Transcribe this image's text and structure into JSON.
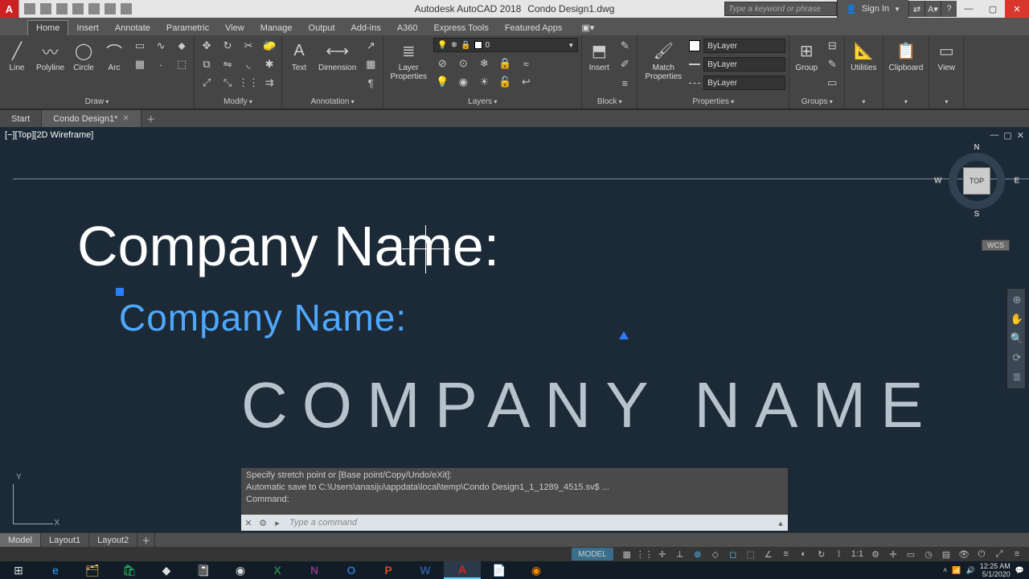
{
  "title": {
    "app": "Autodesk AutoCAD 2018",
    "file": "Condo Design1.dwg"
  },
  "search_placeholder": "Type a keyword or phrase",
  "signin": "Sign In",
  "menutabs": [
    "Home",
    "Insert",
    "Annotate",
    "Parametric",
    "View",
    "Manage",
    "Output",
    "Add-ins",
    "A360",
    "Express Tools",
    "Featured Apps"
  ],
  "ribbon": {
    "draw": {
      "title": "Draw",
      "btns": [
        "Line",
        "Polyline",
        "Circle",
        "Arc"
      ]
    },
    "modify": {
      "title": "Modify"
    },
    "annotation": {
      "title": "Annotation",
      "btns": [
        "Text",
        "Dimension"
      ]
    },
    "layers": {
      "title": "Layers",
      "btn": "Layer Properties",
      "current": "0"
    },
    "block": {
      "title": "Block",
      "btns": [
        "Insert"
      ]
    },
    "properties": {
      "title": "Properties",
      "match": "Match Properties",
      "color": "ByLayer",
      "lw": "ByLayer",
      "lt": "ByLayer"
    },
    "groups": {
      "title": "Groups",
      "btn": "Group"
    },
    "utilities": {
      "title": "Utilities"
    },
    "clipboard": {
      "title": "Clipboard"
    },
    "view": {
      "title": "View"
    }
  },
  "filetabs": {
    "start": "Start",
    "active": "Condo Design1*"
  },
  "viewport_label": "[−][Top][2D Wireframe]",
  "canvas": {
    "text1": "Company Name:",
    "text2": "Company Name:",
    "text3": "COMPANY  NAME"
  },
  "viewcube": {
    "face": "TOP",
    "n": "N",
    "s": "S",
    "e": "E",
    "w": "W",
    "wcs": "WCS"
  },
  "cmd": {
    "line1": "Specify stretch point or [Base point/Copy/Undo/eXit]:",
    "line2": "Automatic save to C:\\Users\\anasiju\\appdata\\local\\temp\\Condo Design1_1_1289_4515.sv$ ...",
    "line3": "Command:",
    "placeholder": "Type a command"
  },
  "layouts": [
    "Model",
    "Layout1",
    "Layout2"
  ],
  "status": {
    "model": "MODEL",
    "scale": "1:1"
  },
  "clock": {
    "time": "12:25 AM",
    "date": "5/1/2020"
  }
}
